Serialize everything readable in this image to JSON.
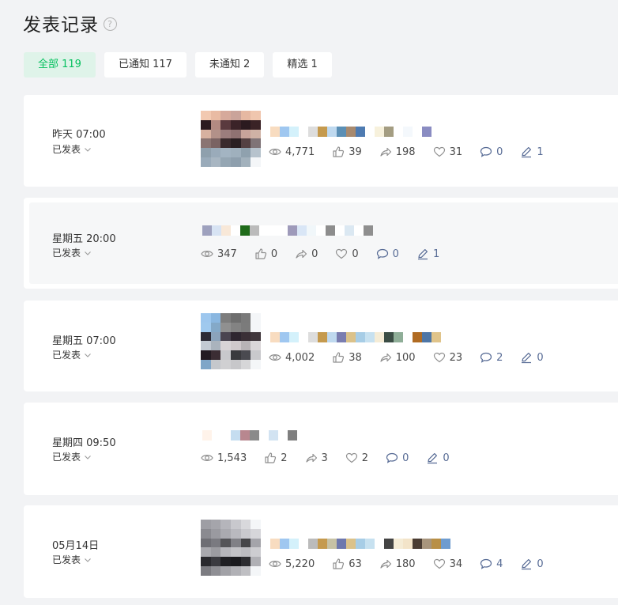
{
  "header": {
    "title": "发表记录",
    "help_icon": "?"
  },
  "tabs": [
    {
      "label": "全部 119",
      "active": true
    },
    {
      "label": "已通知 117",
      "active": false
    },
    {
      "label": "未通知 2",
      "active": false
    },
    {
      "label": "精选 1",
      "active": false
    }
  ],
  "records": [
    {
      "when": "昨天 07:00",
      "status": "已发表",
      "has_thumb": true,
      "stats": {
        "views": "4,771",
        "likes": "39",
        "shares": "198",
        "favorites": "31",
        "comments": "0",
        "edits": "1"
      }
    },
    {
      "when": "星期五 20:00",
      "status": "已发表",
      "has_thumb": false,
      "stats": {
        "views": "347",
        "likes": "0",
        "shares": "0",
        "favorites": "0",
        "comments": "0",
        "edits": "1"
      }
    },
    {
      "when": "星期五 07:00",
      "status": "已发表",
      "has_thumb": true,
      "stats": {
        "views": "4,002",
        "likes": "38",
        "shares": "100",
        "favorites": "23",
        "comments": "2",
        "edits": "0"
      }
    },
    {
      "when": "星期四 09:50",
      "status": "已发表",
      "has_thumb": false,
      "stats": {
        "views": "1,543",
        "likes": "2",
        "shares": "3",
        "favorites": "2",
        "comments": "0",
        "edits": "0"
      }
    },
    {
      "when": "05月14日",
      "status": "已发表",
      "has_thumb": true,
      "stats": {
        "views": "5,220",
        "likes": "63",
        "shares": "180",
        "favorites": "34",
        "comments": "4",
        "edits": "0"
      }
    }
  ]
}
